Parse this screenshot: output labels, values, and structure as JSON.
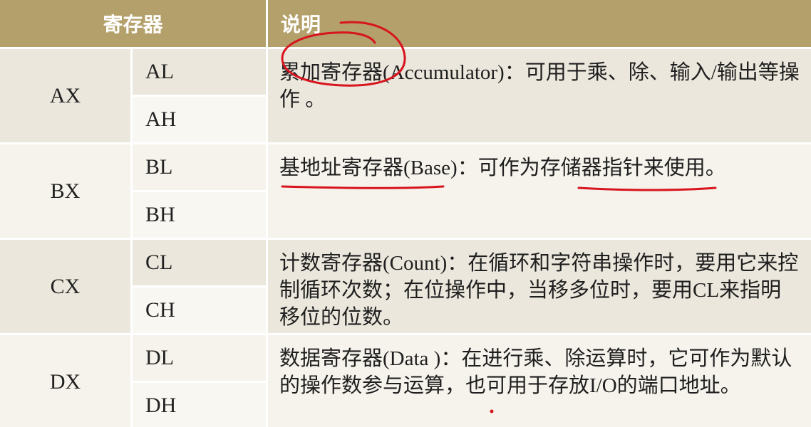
{
  "header": {
    "register_label": "寄存器",
    "description_label": "说明"
  },
  "rows": [
    {
      "reg16": "AX",
      "low": "AL",
      "high": "AH",
      "description": "累加寄存器(Accumulator)：可用于乘、除、输入/输出等操作 。"
    },
    {
      "reg16": "BX",
      "low": "BL",
      "high": "BH",
      "description": "基地址寄存器(Base)：可作为存储器指针来使用。"
    },
    {
      "reg16": "CX",
      "low": "CL",
      "high": "CH",
      "description": "计数寄存器(Count)：在循环和字符串操作时，要用它来控制循环次数；在位操作中，当移多位时，要用CL来指明移位的位数。"
    },
    {
      "reg16": "DX",
      "low": "DL",
      "high": "DH",
      "description": "数据寄存器(Data )：在进行乘、除运算时，它可作为默认的操作数参与运算，也可用于存放I/O的端口地址。"
    }
  ],
  "colors": {
    "header_bg": "#b3a06a",
    "row_bg": "#ebe7dc",
    "annotation_ink": "#d8141e"
  }
}
